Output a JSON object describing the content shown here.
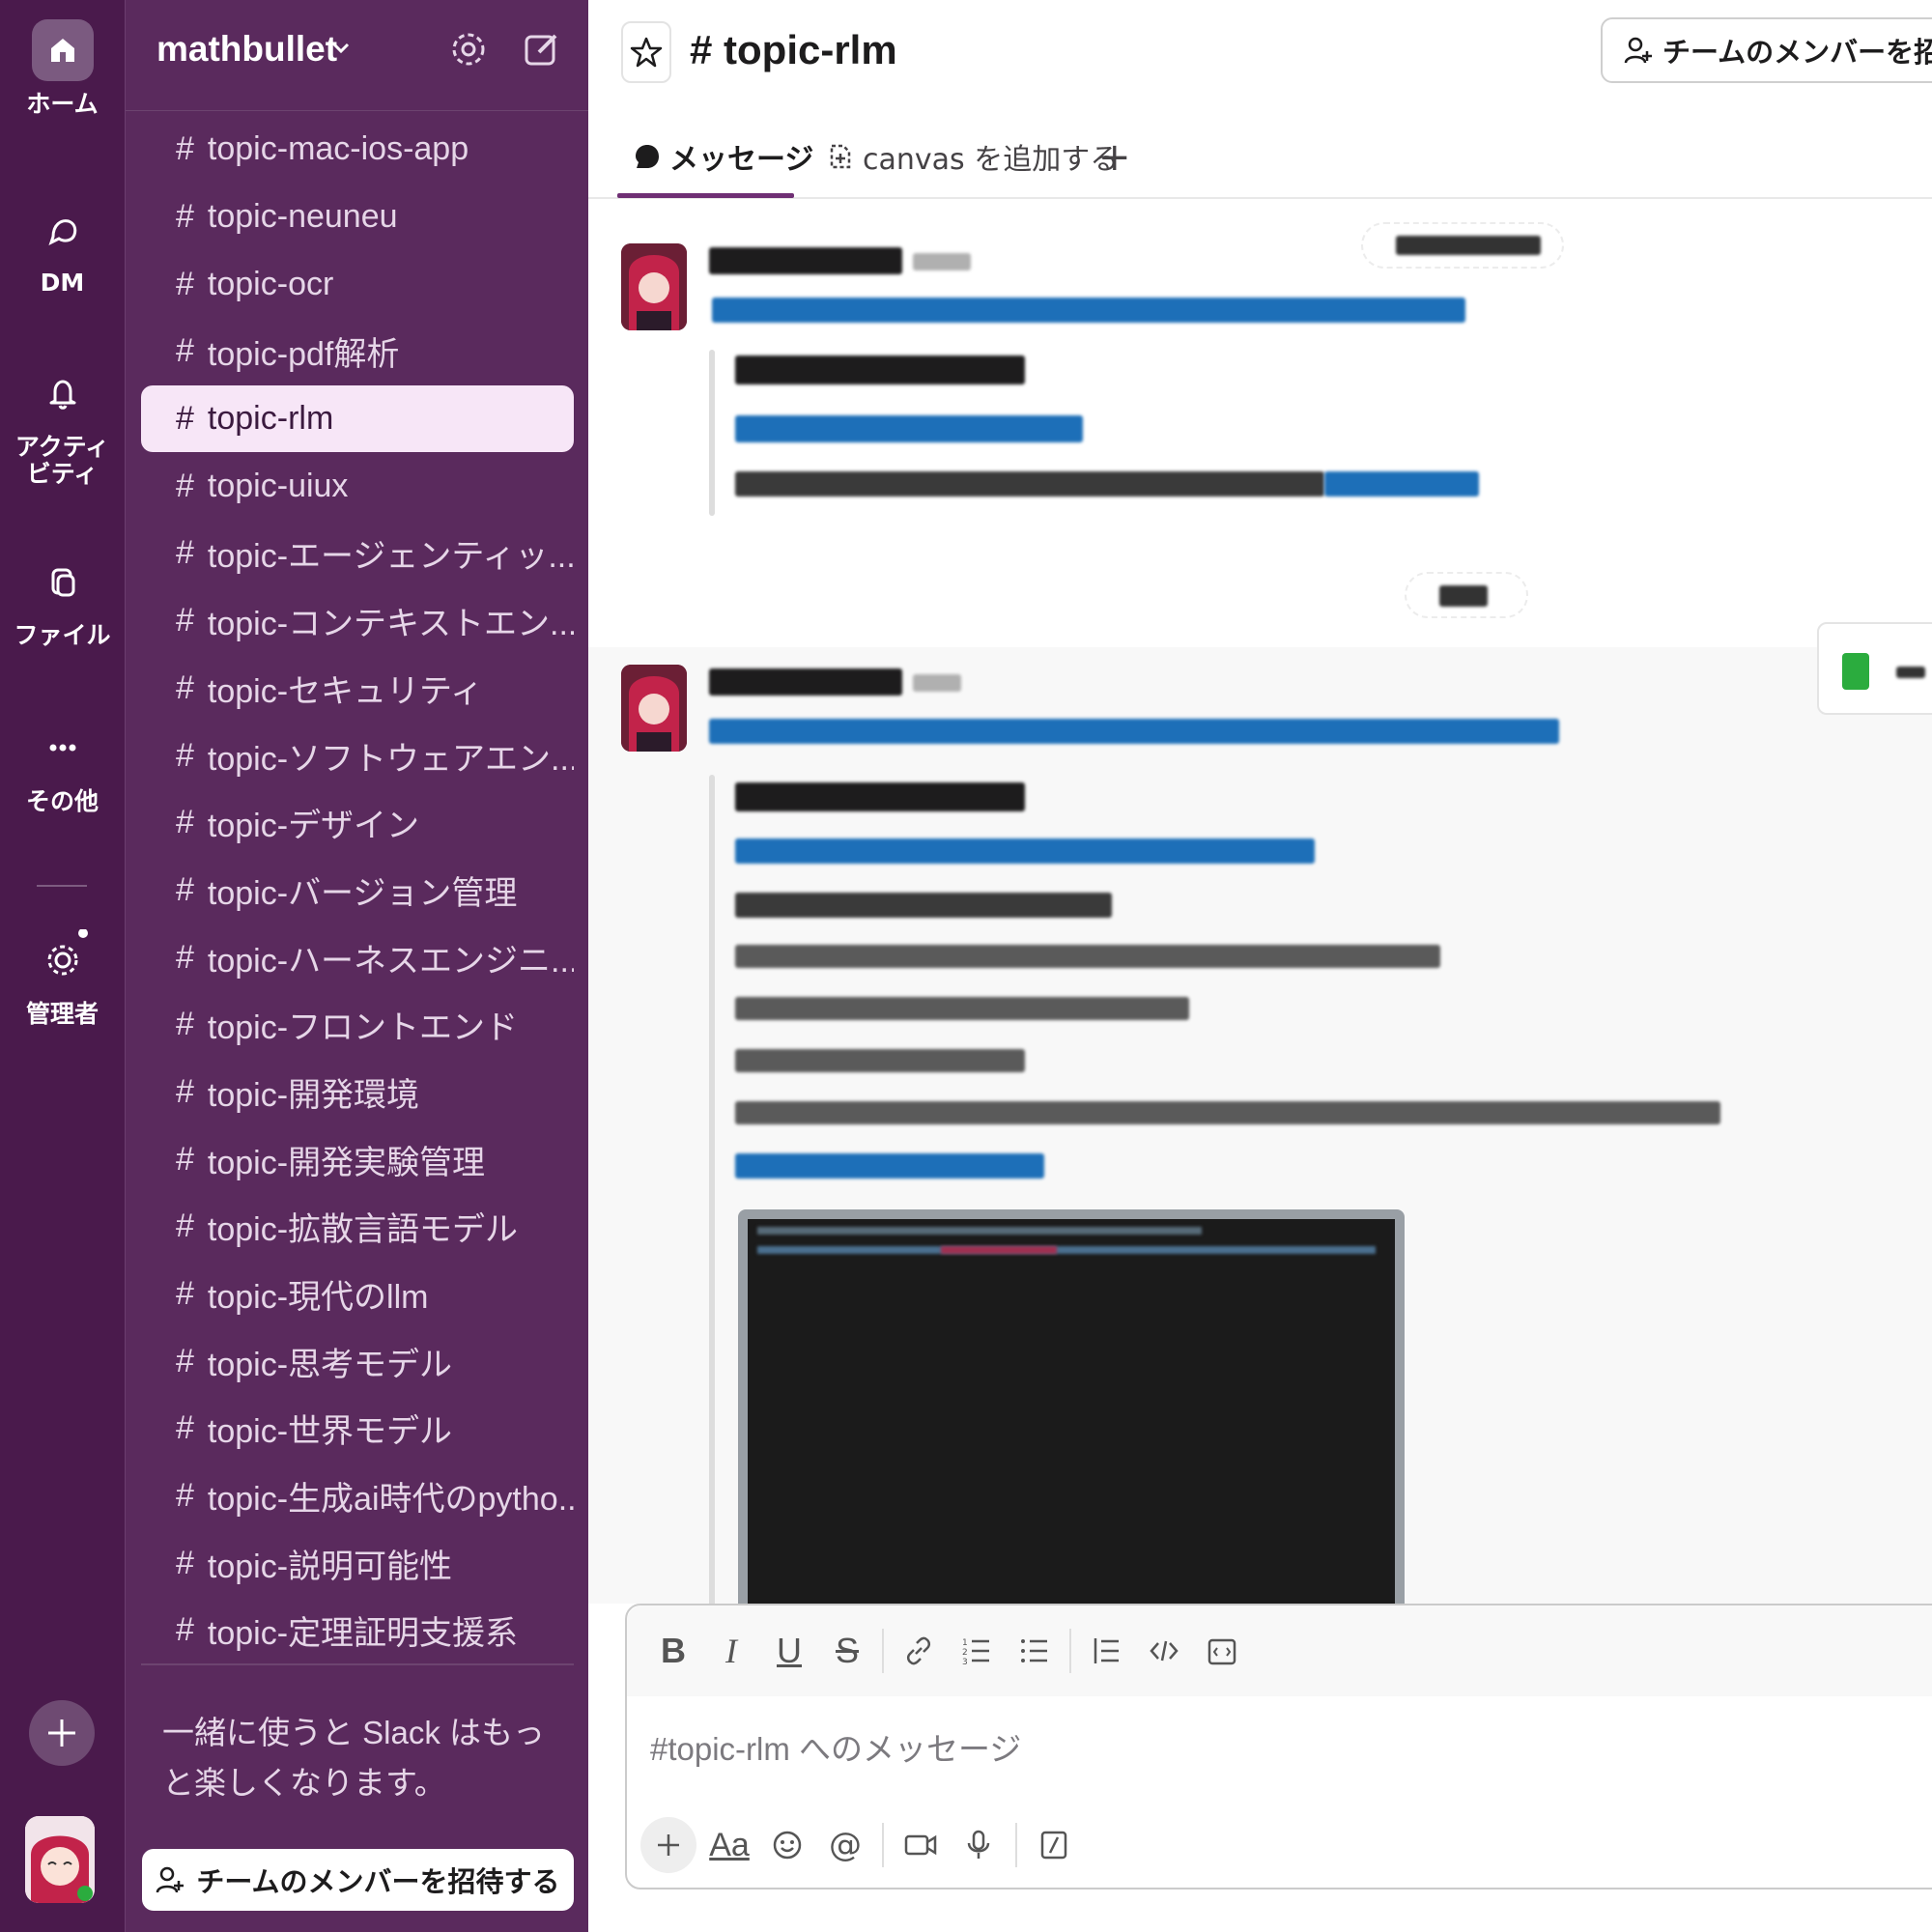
{
  "rail": {
    "home_label": "ホーム",
    "dm_label": "DM",
    "activity_label": "アクティ\nビティ",
    "files_label": "ファイル",
    "more_label": "その他",
    "admin_label": "管理者"
  },
  "workspace": {
    "name": "mathbullet"
  },
  "channels": [
    "topic-mac-ios-app",
    "topic-neuneu",
    "topic-ocr",
    "topic-pdf解析",
    "topic-rlm",
    "topic-uiux",
    "topic-エージェンティッ...",
    "topic-コンテキストエン...",
    "topic-セキュリティ",
    "topic-ソフトウェアエン...",
    "topic-デザイン",
    "topic-バージョン管理",
    "topic-ハーネスエンジニ...",
    "topic-フロントエンド",
    "topic-開発環境",
    "topic-開発実験管理",
    "topic-拡散言語モデル",
    "topic-現代のllm",
    "topic-思考モデル",
    "topic-世界モデル",
    "topic-生成ai時代のpytho...",
    "topic-説明可能性",
    "topic-定理証明支援系"
  ],
  "active_channel_index": 4,
  "sidebar": {
    "promo_text": "一緒に使うと Slack はもっと楽しくなります。",
    "invite_label": "チームのメンバーを招待する"
  },
  "header": {
    "channel_title": "# topic-rlm",
    "invite_label": "チームのメンバーを招待する"
  },
  "tabs": {
    "messages": "メッセージ",
    "canvas": "canvas を追加する",
    "add": "+"
  },
  "composer": {
    "placeholder": "#topic-rlm へのメッセージ"
  },
  "colors": {
    "rail_bg": "#4a1a4c",
    "sidebar_bg": "#5a2a5d",
    "active_channel_bg": "#f7e6f7",
    "link_blue": "#1d6fb8",
    "tab_underline": "#6f2f74"
  }
}
